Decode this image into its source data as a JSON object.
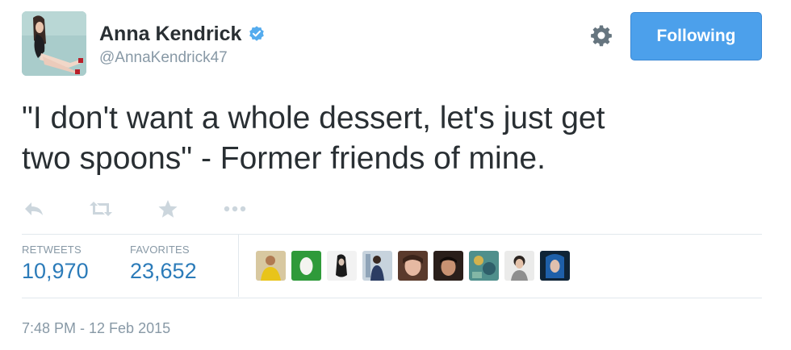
{
  "tweet": {
    "author": {
      "name": "Anna Kendrick",
      "handle": "@AnnaKendrick47",
      "verified": true,
      "avatar_icon": "profile-photo"
    },
    "follow_button_label": "Following",
    "settings_icon": "gear-icon",
    "text_line1": "\"I don't want a whole dessert, let's just get",
    "text_line2": "two spoons\" - Former friends of mine.",
    "actions": [
      {
        "name": "reply",
        "icon": "reply-icon"
      },
      {
        "name": "retweet",
        "icon": "retweet-icon"
      },
      {
        "name": "favorite",
        "icon": "star-icon"
      },
      {
        "name": "more",
        "icon": "more-icon"
      }
    ],
    "stats": {
      "retweets_label": "RETWEETS",
      "retweets_value": "10,970",
      "favorites_label": "FAVORITES",
      "favorites_value": "23,652"
    },
    "favoriter_avatars": [
      "favoriter-avatar-1",
      "favoriter-avatar-2",
      "favoriter-avatar-3",
      "favoriter-avatar-4",
      "favoriter-avatar-5",
      "favoriter-avatar-6",
      "favoriter-avatar-7",
      "favoriter-avatar-8",
      "favoriter-avatar-9"
    ],
    "timestamp": "7:48 PM - 12 Feb 2015"
  },
  "colors": {
    "link_blue": "#2b7bb9",
    "follow_button": "#4ca0eb",
    "muted_text": "#8899a6",
    "action_icon": "#ccd6dd",
    "verified_badge": "#55acee",
    "divider": "#e1e8ed"
  }
}
